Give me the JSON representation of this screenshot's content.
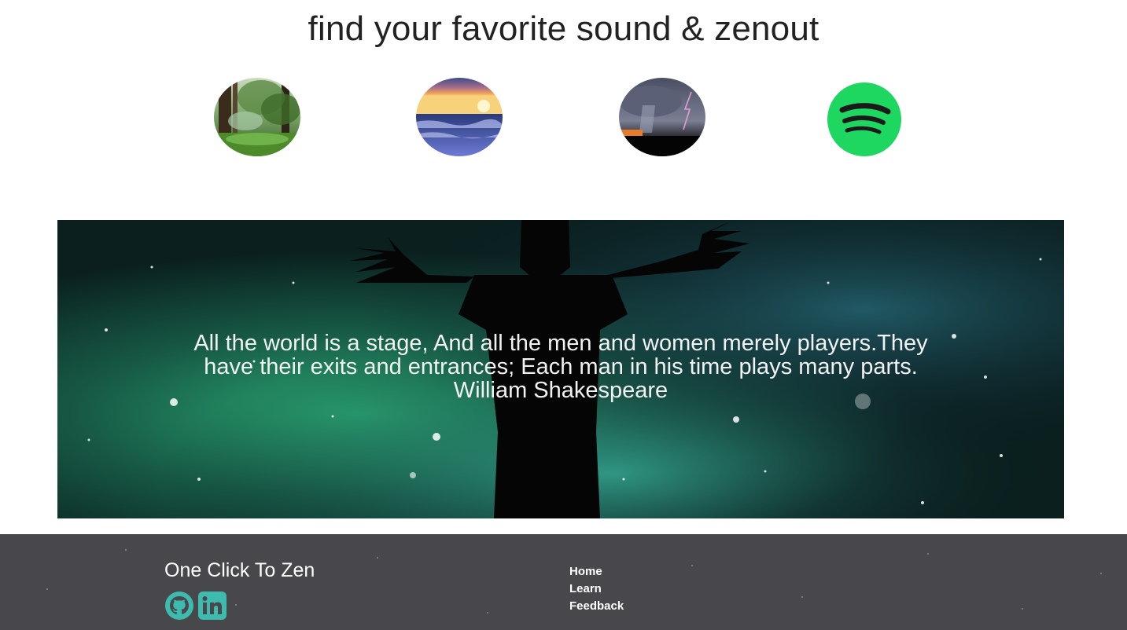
{
  "header": {
    "title": "find your favorite sound & zenout"
  },
  "sounds": [
    {
      "name": "forest"
    },
    {
      "name": "ocean-sunset"
    },
    {
      "name": "thunderstorm"
    },
    {
      "name": "spotify"
    }
  ],
  "quote": {
    "line1": "All the world is a stage, And all the men and women merely players.They",
    "line2": "have their exits and entrances; Each man in his time plays many parts.",
    "author": "William Shakespeare"
  },
  "footer": {
    "brand": "One Click To Zen",
    "social": [
      {
        "icon": "github-icon"
      },
      {
        "icon": "linkedin-icon"
      }
    ],
    "nav": {
      "home": "Home",
      "learn": "Learn",
      "feedback": "Feedback"
    }
  },
  "colors": {
    "footer_bg": "#48474c",
    "social_accent": "#3dbbae",
    "spotify_green": "#1ed760",
    "title_text": "#222222"
  }
}
